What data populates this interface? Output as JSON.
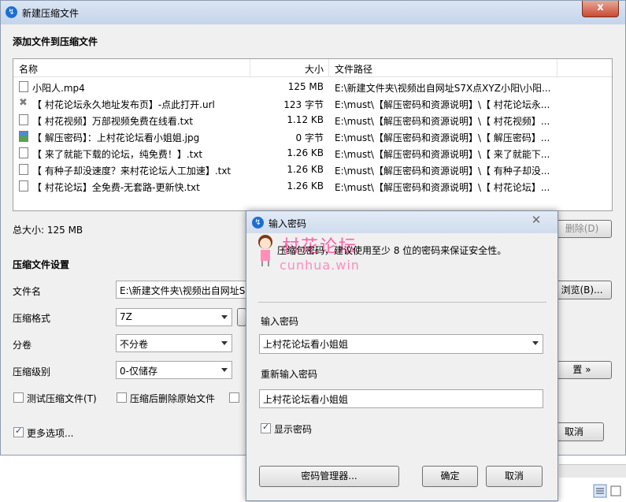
{
  "window": {
    "title": "新建压缩文件",
    "close_glyph": "x"
  },
  "add_section": {
    "title": "添加文件到压缩文件"
  },
  "file_list": {
    "headers": {
      "name": "名称",
      "size": "大小",
      "path": "文件路径"
    },
    "rows": [
      {
        "icon": "video-file-icon",
        "name": "小阳人.mp4",
        "size": "125 MB",
        "path": "E:\\新建文件夹\\视频出自网址S7X点XYZ小阳\\小阳..."
      },
      {
        "icon": "url-file-icon",
        "name": "【 村花论坛永久地址发布页】-点此打开.url",
        "size": "123 字节",
        "path": "E:\\must\\【解压密码和资源说明】\\【 村花论坛永..."
      },
      {
        "icon": "text-file-icon",
        "name": "【 村花视频】万部视频免费在线看.txt",
        "size": "1.12 KB",
        "path": "E:\\must\\【解压密码和资源说明】\\【 村花视频】..."
      },
      {
        "icon": "image-file-icon",
        "name": "【 解压密码】：上村花论坛看小姐姐.jpg",
        "size": "0 字节",
        "path": "E:\\must\\【解压密码和资源说明】\\【 解压密码】..."
      },
      {
        "icon": "text-file-icon",
        "name": "【 来了就能下载的论坛，纯免费！】.txt",
        "size": "1.26 KB",
        "path": "E:\\must\\【解压密码和资源说明】\\【 来了就能下..."
      },
      {
        "icon": "text-file-icon",
        "name": "【 有种子却没速度？来村花论坛人工加速】.txt",
        "size": "1.26 KB",
        "path": "E:\\must\\【解压密码和资源说明】\\【 有种子却没..."
      },
      {
        "icon": "text-file-icon",
        "name": "【 村花论坛】全免费-无套路-更新快.txt",
        "size": "1.26 KB",
        "path": "E:\\must\\【解压密码和资源说明】\\【 村花论坛】..."
      }
    ]
  },
  "total_size": "总大小: 125 MB",
  "delete_button": "删除(D)",
  "settings": {
    "title": "压缩文件设置",
    "filename_label": "文件名",
    "filename_value": "E:\\新建文件夹\\视频出自网址S7",
    "browse_button": "浏览(B)...",
    "format_label": "压缩格式",
    "format_value": "7Z",
    "volume_label": "分卷",
    "volume_value": "不分卷",
    "level_label": "压缩级别",
    "level_value": "0-仅储存",
    "advanced_button": "置 »",
    "test_label": "测试压缩文件(T)",
    "delete_after_label": "压缩后删除原始文件",
    "more_options_label": "更多选项...",
    "cancel_button": "取消"
  },
  "dialog": {
    "title": "输入密码",
    "watermark_title": "村花论坛",
    "watermark_sub": "cunhua.win",
    "hint": "压缩包密码，建议使用至少 8 位的密码来保证安全性。",
    "password_label": "输入密码",
    "password_value": "上村花论坛看小姐姐",
    "reenter_label": "重新输入密码",
    "reenter_value": "上村花论坛看小姐姐",
    "show_password_label": "显示密码",
    "manager_button": "密码管理器...",
    "ok_button": "确定",
    "cancel_button": "取消"
  }
}
